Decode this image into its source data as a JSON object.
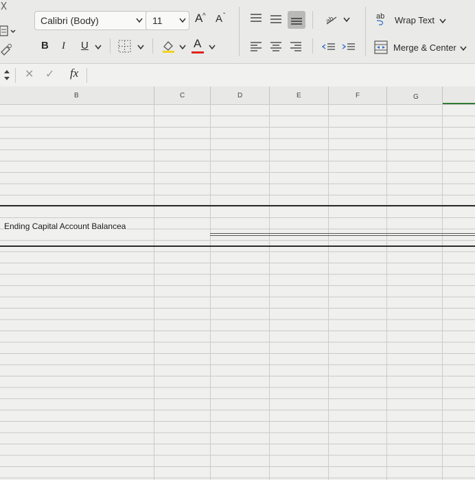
{
  "toolbar": {
    "font_name": "Calibri (Body)",
    "font_size": "11",
    "grow_font_label": "A",
    "shrink_font_label": "A",
    "bold_label": "B",
    "italic_label": "I",
    "underline_label": "U",
    "font_color_letter": "A",
    "wrap_text_label": "Wrap Text",
    "merge_center_label": "Merge & Center",
    "wrap_icon_glyph": "ab"
  },
  "formula_bar": {
    "fx_label": "fx",
    "cancel_glyph": "✕",
    "confirm_glyph": "✓",
    "content": ""
  },
  "columns": [
    "B",
    "C",
    "D",
    "E",
    "F",
    "G"
  ],
  "cells": {
    "ending_label": "Ending Capital Account Balancea"
  },
  "colors": {
    "font_color_underline": "#e0231b",
    "fill_color_underline": "#f2d21a",
    "selected_align_bg": "#b9b9b7"
  }
}
